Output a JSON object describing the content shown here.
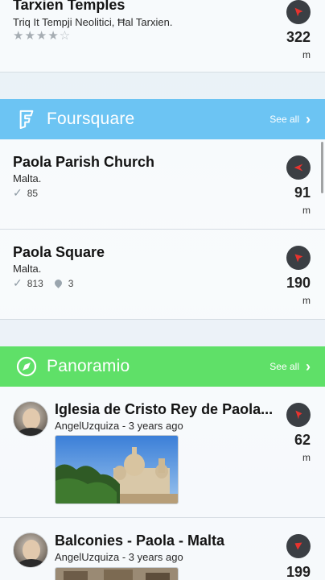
{
  "top_item": {
    "title": "Tarxien Temples",
    "address": "Triq It Tempji Neolitici, Ħal Tarxien.",
    "rating": 4,
    "rating_max": 5,
    "distance": "322",
    "unit": "m"
  },
  "foursquare": {
    "title": "Foursquare",
    "see_all": "See all",
    "color": "#6cc4f3",
    "items": [
      {
        "title": "Paola Parish Church",
        "location": "Malta.",
        "checkins": "85",
        "distance": "91",
        "unit": "m"
      },
      {
        "title": "Paola Square",
        "location": "Malta.",
        "checkins": "813",
        "tips": "3",
        "distance": "190",
        "unit": "m"
      }
    ]
  },
  "panoramio": {
    "title": "Panoramio",
    "see_all": "See all",
    "color": "#5fe068",
    "items": [
      {
        "title": "Iglesia de Cristo Rey de Paola...",
        "author": "AngelUzquiza",
        "time": "3 years ago",
        "separator": " - ",
        "distance": "62",
        "unit": "m"
      },
      {
        "title": "Balconies - Paola - Malta",
        "author": "AngelUzquiza",
        "time": "3 years ago",
        "separator": " - ",
        "distance": "199"
      }
    ]
  },
  "icons": {
    "compass": "compass-arrow-icon",
    "check": "checkmark-icon",
    "tip": "pin-icon",
    "chevron": "chevron-right-icon",
    "foursquare_logo": "foursquare-logo-icon",
    "panoramio_logo": "panoramio-logo-icon"
  }
}
